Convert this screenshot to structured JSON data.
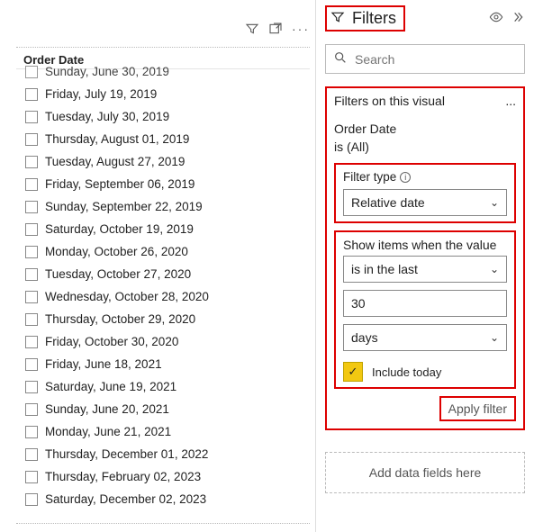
{
  "visual": {
    "toolbar": {
      "more": "···"
    },
    "header": "Order Date",
    "rowsFirstPartial": "Sunday, June 30, 2019",
    "rows": [
      "Friday, July 19, 2019",
      "Tuesday, July 30, 2019",
      "Thursday, August 01, 2019",
      "Tuesday, August 27, 2019",
      "Friday, September 06, 2019",
      "Sunday, September 22, 2019",
      "Saturday, October 19, 2019",
      "Monday, October 26, 2020",
      "Tuesday, October 27, 2020",
      "Wednesday, October 28, 2020",
      "Thursday, October 29, 2020",
      "Friday, October 30, 2020",
      "Friday, June 18, 2021",
      "Saturday, June 19, 2021",
      "Sunday, June 20, 2021",
      "Monday, June 21, 2021",
      "Thursday, December 01, 2022",
      "Thursday, February 02, 2023",
      "Saturday, December 02, 2023"
    ]
  },
  "filters": {
    "title": "Filters",
    "search_placeholder": "Search",
    "section_title": "Filters on this visual",
    "section_more": "...",
    "field_name": "Order Date",
    "field_status": "is (All)",
    "filter_type_label": "Filter type",
    "filter_type_info": "ⓘ",
    "filter_type_value": "Relative date",
    "show_label": "Show items when the value",
    "relation_value": "is in the last",
    "number_value": "30",
    "unit_value": "days",
    "include_label": "Include today",
    "include_checkmark": "✓",
    "apply_label": "Apply filter",
    "add_fields": "Add data fields here"
  }
}
